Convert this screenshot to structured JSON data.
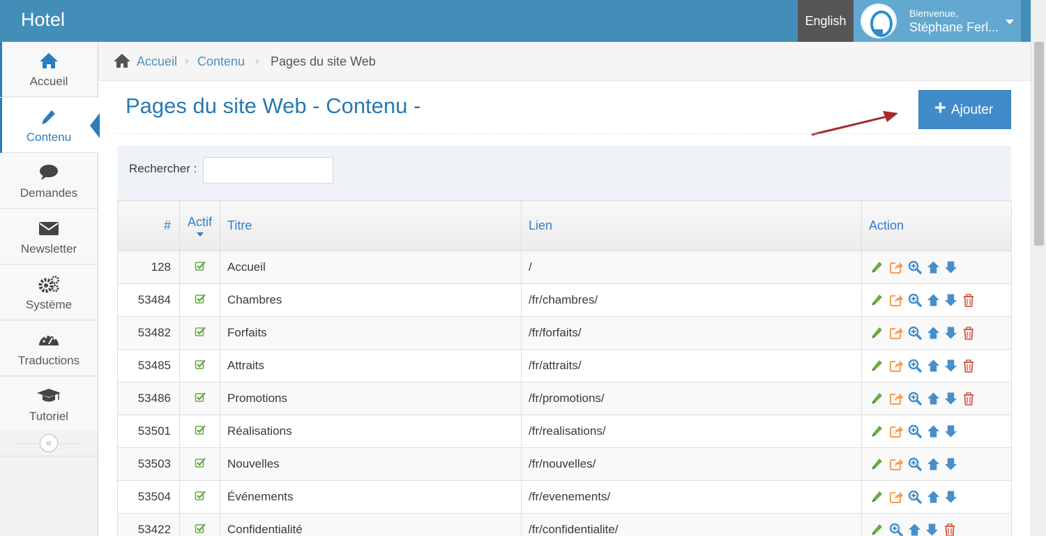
{
  "app": {
    "brand": "Hotel"
  },
  "header": {
    "language": "English",
    "user": {
      "greeting": "Bienvenue,",
      "name": "Stéphane Ferl..."
    }
  },
  "sidebar": {
    "items": [
      {
        "label": "Accueil",
        "icon": "home-icon"
      },
      {
        "label": "Contenu",
        "icon": "pencil-icon",
        "active": true
      },
      {
        "label": "Demandes",
        "icon": "comment-icon"
      },
      {
        "label": "Newsletter",
        "icon": "envelope-icon"
      },
      {
        "label": "Système",
        "icon": "cogs-icon"
      },
      {
        "label": "Traductions",
        "icon": "dashboard-icon"
      },
      {
        "label": "Tutoriel",
        "icon": "graduation-cap-icon"
      }
    ],
    "collapse_glyph": "«"
  },
  "breadcrumb": {
    "home": "Accueil",
    "section": "Contenu",
    "current": "Pages du site Web"
  },
  "page": {
    "title": "Pages du site Web - Contenu -",
    "add_label": "Ajouter"
  },
  "search": {
    "label": "Rechercher :",
    "value": ""
  },
  "table": {
    "columns": {
      "num": "#",
      "actif": "Actif",
      "titre": "Titre",
      "lien": "Lien",
      "action": "Action"
    },
    "rows": [
      {
        "id": "128",
        "titre": "Accueil",
        "lien": "/",
        "actions": [
          "edit",
          "share",
          "zoom",
          "up",
          "down"
        ]
      },
      {
        "id": "53484",
        "titre": "Chambres",
        "lien": "/fr/chambres/",
        "actions": [
          "edit",
          "share",
          "zoom",
          "up",
          "down",
          "trash"
        ]
      },
      {
        "id": "53482",
        "titre": "Forfaits",
        "lien": "/fr/forfaits/",
        "actions": [
          "edit",
          "share",
          "zoom",
          "up",
          "down",
          "trash"
        ]
      },
      {
        "id": "53485",
        "titre": "Attraits",
        "lien": "/fr/attraits/",
        "actions": [
          "edit",
          "share",
          "zoom",
          "up",
          "down",
          "trash"
        ]
      },
      {
        "id": "53486",
        "titre": "Promotions",
        "lien": "/fr/promotions/",
        "actions": [
          "edit",
          "share",
          "zoom",
          "up",
          "down",
          "trash"
        ]
      },
      {
        "id": "53501",
        "titre": "Réalisations",
        "lien": "/fr/realisations/",
        "actions": [
          "edit",
          "share",
          "zoom",
          "up",
          "down"
        ]
      },
      {
        "id": "53503",
        "titre": "Nouvelles",
        "lien": "/fr/nouvelles/",
        "actions": [
          "edit",
          "share",
          "zoom",
          "up",
          "down"
        ]
      },
      {
        "id": "53504",
        "titre": "Événements",
        "lien": "/fr/evenements/",
        "actions": [
          "edit",
          "share",
          "zoom",
          "up",
          "down"
        ]
      },
      {
        "id": "53422",
        "titre": "Confidentialité",
        "lien": "/fr/confidentialite/",
        "actions": [
          "edit",
          "zoom",
          "up",
          "down",
          "trash"
        ]
      }
    ]
  },
  "colors": {
    "navbar": "#438eb9",
    "link": "#4c8fbd",
    "title": "#2679b5",
    "primary_button": "#428bca",
    "edit": "#69aa46",
    "share": "#f89c4d",
    "nav": "#478fca",
    "delete": "#d15b47",
    "annotation_arrow": "#a52a2a"
  }
}
